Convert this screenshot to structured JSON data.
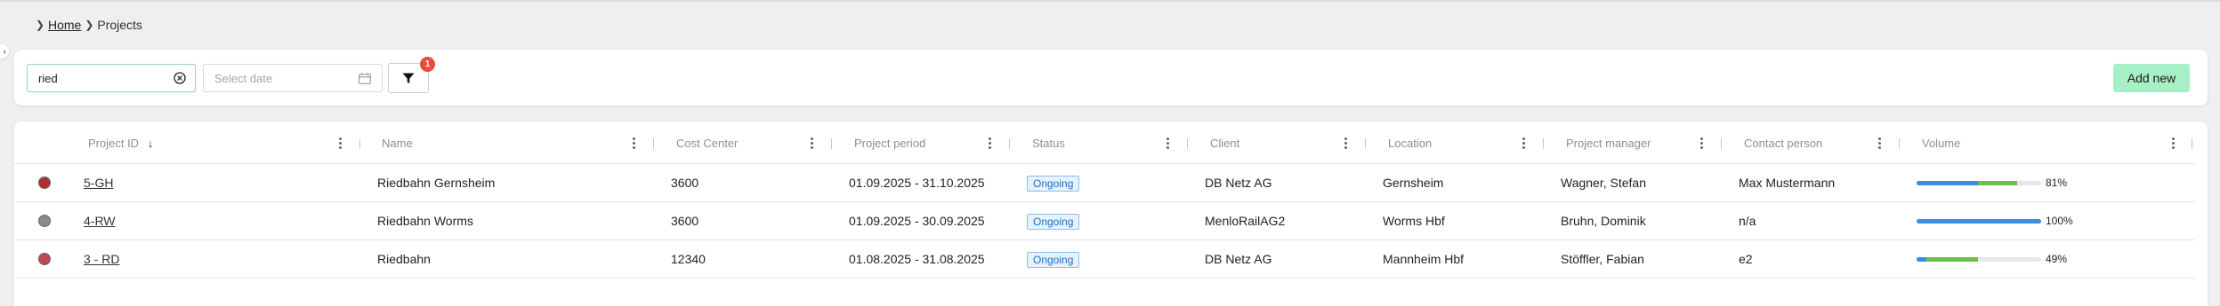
{
  "breadcrumb": {
    "home_label": "Home",
    "current_label": "Projects"
  },
  "toolbar": {
    "search_value": "ried",
    "date_placeholder": "Select date",
    "filter_count": "1",
    "add_label": "Add new"
  },
  "table": {
    "columns": [
      {
        "key": "project_id",
        "label": "Project ID"
      },
      {
        "key": "name",
        "label": "Name"
      },
      {
        "key": "cost_center",
        "label": "Cost Center"
      },
      {
        "key": "period",
        "label": "Project period"
      },
      {
        "key": "status",
        "label": "Status"
      },
      {
        "key": "client",
        "label": "Client"
      },
      {
        "key": "location",
        "label": "Location"
      },
      {
        "key": "manager",
        "label": "Project manager"
      },
      {
        "key": "contact",
        "label": "Contact person"
      },
      {
        "key": "volume",
        "label": "Volume"
      }
    ],
    "rows": [
      {
        "dot_color": "#b03030",
        "project_id": "5-GH",
        "name": "Riedbahn Gernsheim",
        "cost_center": "3600",
        "period": "01.09.2025 - 31.10.2025",
        "status": "Ongoing",
        "client": "DB Netz AG",
        "location": "Gernsheim",
        "manager": "Wagner, Stefan",
        "contact": "Max Mustermann",
        "volume_green": 0.81,
        "volume_blue": 0.49,
        "volume_label": "81%"
      },
      {
        "dot_color": "#8c8c8c",
        "project_id": "4-RW",
        "name": "Riedbahn Worms",
        "cost_center": "3600",
        "period": "01.09.2025 - 30.09.2025",
        "status": "Ongoing",
        "client": "MenloRailAG2",
        "location": "Worms Hbf",
        "manager": "Bruhn, Dominik",
        "contact": "n/a",
        "volume_green": 0.0,
        "volume_blue": 1.0,
        "volume_label": "100%"
      },
      {
        "dot_color": "#c0484f",
        "project_id": "3 - RD",
        "name": "Riedbahn",
        "cost_center": "12340",
        "period": "01.08.2025 - 31.08.2025",
        "status": "Ongoing",
        "client": "DB Netz AG",
        "location": "Mannheim Hbf",
        "manager": "Stöffler, Fabian",
        "contact": "e2",
        "volume_green": 0.49,
        "volume_blue": 0.08,
        "volume_label": "49%"
      }
    ]
  },
  "colors": {
    "accent_green": "#a7efc5",
    "badge_red": "#e74c3c",
    "status_blue": "#1c6fbf"
  }
}
